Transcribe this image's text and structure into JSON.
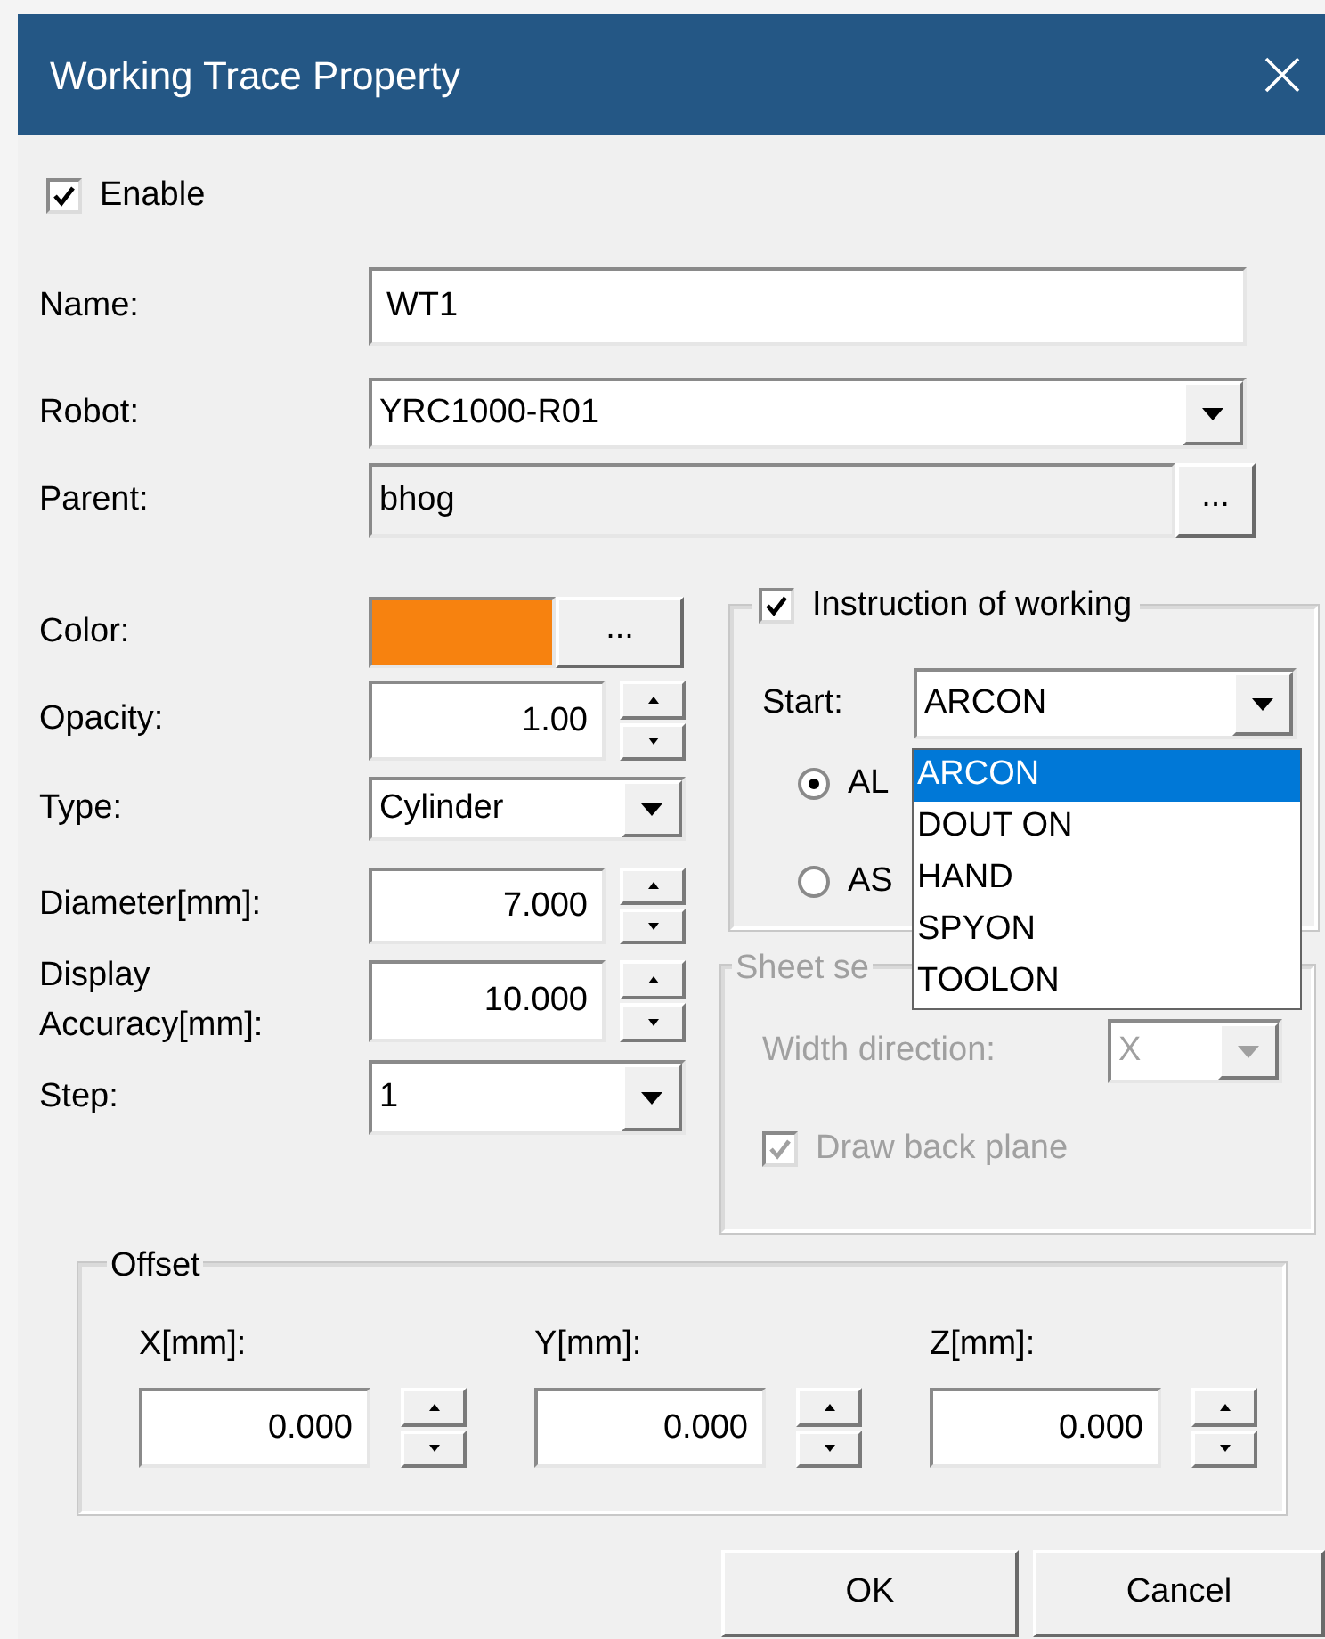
{
  "window": {
    "title": "Working Trace Property"
  },
  "enable": {
    "label": "Enable",
    "checked": true
  },
  "fields": [
    {
      "kind": "text",
      "label": "Name:",
      "value": "WT1"
    },
    {
      "kind": "select",
      "label": "Robot:",
      "value": "YRC1000-R01"
    },
    {
      "kind": "browse",
      "label": "Parent:",
      "value": "bhog",
      "button": "..."
    }
  ],
  "display": [
    {
      "kind": "color",
      "label": "Color:",
      "color": "#f7820f",
      "button": "..."
    },
    {
      "kind": "spin",
      "label": "Opacity:",
      "value": "1.00"
    },
    {
      "kind": "select",
      "label": "Type:",
      "value": "Cylinder"
    },
    {
      "kind": "spin",
      "label": "Diameter[mm]:",
      "value": "7.000"
    },
    {
      "kind": "spin",
      "label": "Display Accuracy[mm]:",
      "value": "10.000"
    },
    {
      "kind": "select",
      "label": "Step:",
      "value": "1"
    }
  ],
  "instruction": {
    "label": "Instruction of working",
    "checked": true,
    "start_label": "Start:",
    "start_value": "ARCON",
    "radios": [
      {
        "label": "AL",
        "selected": true
      },
      {
        "label": "AS",
        "selected": false
      }
    ],
    "dropdown": [
      {
        "label": "ARCON",
        "selected": true
      },
      {
        "label": "DOUT ON",
        "selected": false
      },
      {
        "label": "HAND",
        "selected": false
      },
      {
        "label": "SPYON",
        "selected": false
      },
      {
        "label": "TOOLON",
        "selected": false
      }
    ]
  },
  "sheet": {
    "legend": "Sheet se",
    "disabled": true,
    "width_label": "Width direction:",
    "width_value": "X",
    "back_plane": {
      "label": "Draw back plane",
      "checked": true
    }
  },
  "offset": {
    "legend": "Offset",
    "fields": [
      {
        "label": "X[mm]:",
        "value": "0.000"
      },
      {
        "label": "Y[mm]:",
        "value": "0.000"
      },
      {
        "label": "Z[mm]:",
        "value": "0.000"
      }
    ]
  },
  "buttons": [
    "OK",
    "Cancel"
  ]
}
